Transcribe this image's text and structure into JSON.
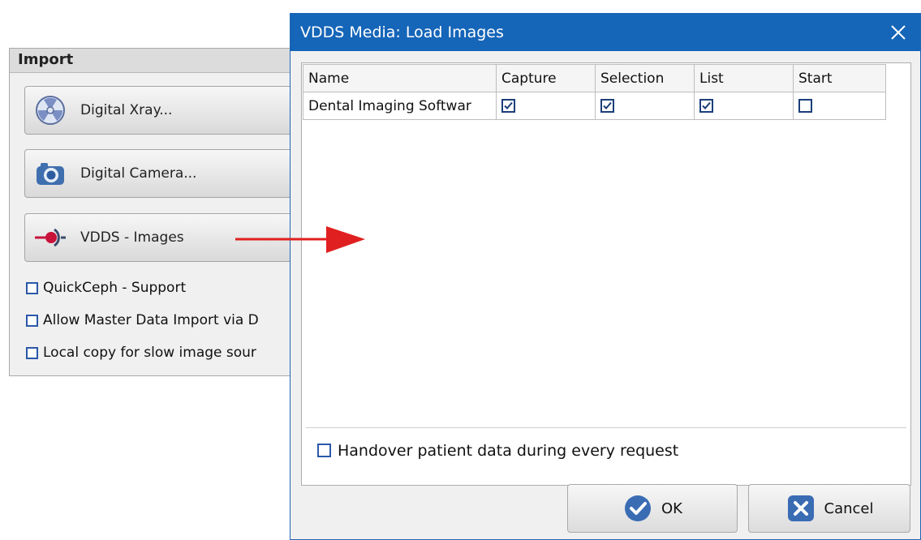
{
  "import_panel": {
    "header": "Import",
    "buttons": [
      {
        "label": "Digital Xray...",
        "icon": "radiation-icon"
      },
      {
        "label": "Digital Camera...",
        "icon": "camera-icon"
      },
      {
        "label": "VDDS - Images",
        "icon": "vdds-plug-icon"
      }
    ],
    "checkboxes": [
      {
        "label": "QuickCeph - Support",
        "checked": false
      },
      {
        "label": "Allow Master Data Import via D",
        "checked": false
      },
      {
        "label": "Local copy for slow image sour",
        "checked": false
      }
    ]
  },
  "dialog": {
    "title": "VDDS Media: Load Images",
    "close_icon": "close-icon",
    "table": {
      "columns": [
        "Name",
        "Capture",
        "Selection",
        "List",
        "Start"
      ],
      "rows": [
        {
          "name": "Dental Imaging Softwar",
          "capture": true,
          "selection": true,
          "list": true,
          "start": false
        }
      ]
    },
    "handover_label": "Handover patient data during every request",
    "handover_checked": false,
    "ok_label": "OK",
    "cancel_label": "Cancel"
  },
  "colors": {
    "titlebar": "#1565b8",
    "arrow": "#e02020",
    "checkbox_border": "#2b58a8"
  }
}
